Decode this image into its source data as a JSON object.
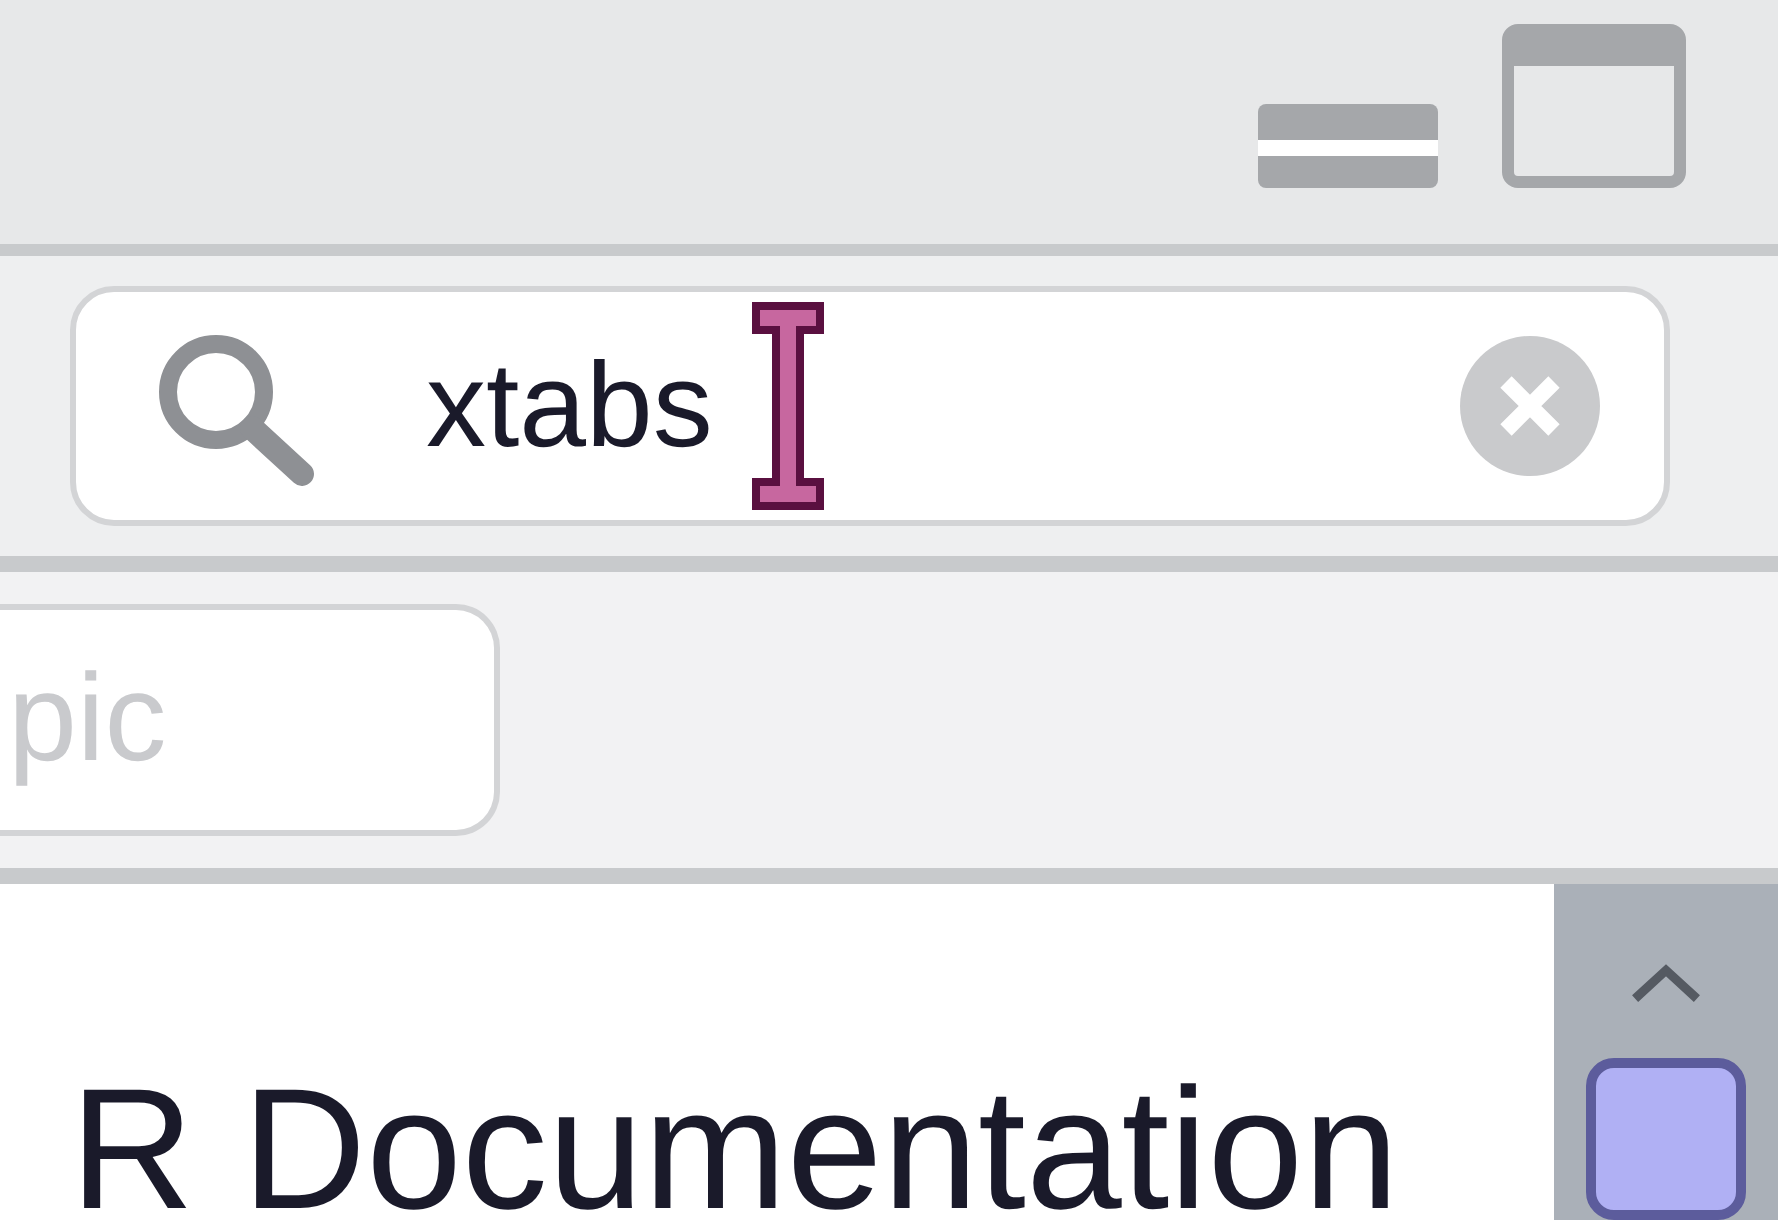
{
  "search": {
    "value": "xtabs"
  },
  "topic_field": {
    "placeholder": "pic"
  },
  "document": {
    "title": "R Documentation"
  }
}
